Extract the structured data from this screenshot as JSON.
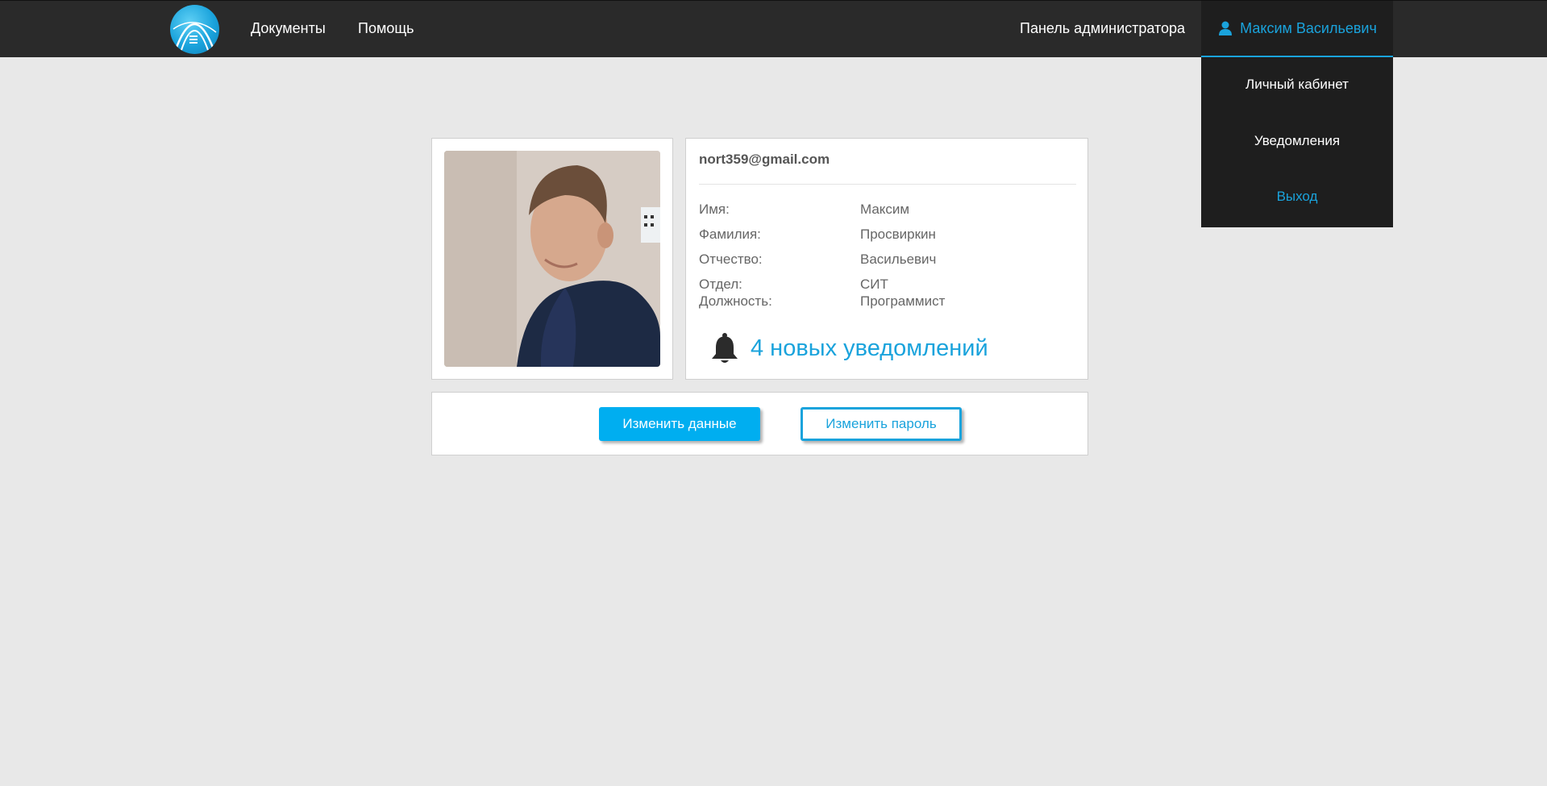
{
  "navbar": {
    "documents_label": "Документы",
    "help_label": "Помощь",
    "admin_panel_label": "Панель администратора",
    "user_name": "Максим Васильевич"
  },
  "user_menu": {
    "items": [
      "Личный кабинет",
      "Уведомления",
      "Выход"
    ]
  },
  "profile": {
    "email": "nort359@gmail.com",
    "fields": [
      {
        "label": "Имя:",
        "value": "Максим"
      },
      {
        "label": "Фамилия:",
        "value": "Просвиркин"
      },
      {
        "label": "Отчество:",
        "value": "Васильевич"
      },
      {
        "label": "Отдел:",
        "value": "СИТ"
      },
      {
        "label": "Должность:",
        "value": "Программист"
      }
    ],
    "notifications_text": "4 новых уведомлений"
  },
  "actions": {
    "edit_data_label": "Изменить данные",
    "change_password_label": "Изменить пароль"
  },
  "colors": {
    "accent": "#1aa3dc",
    "navbar_bg": "#2a2a2a",
    "page_bg": "#e8e8e8"
  }
}
